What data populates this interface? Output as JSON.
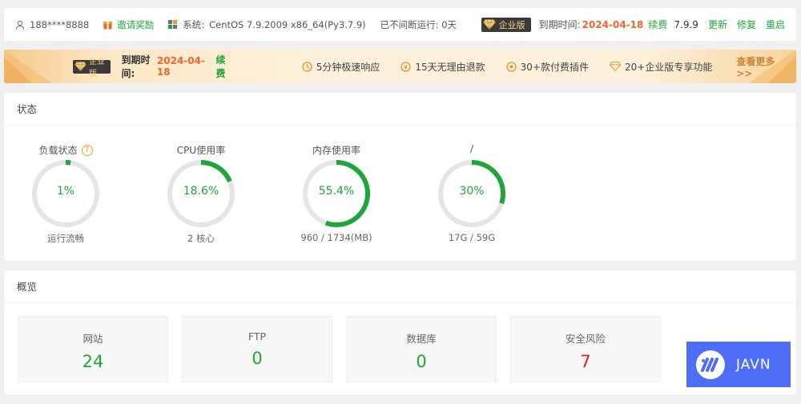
{
  "header": {
    "user": "188****8888",
    "invite": "邀请奖励",
    "system_label": "系统:",
    "system_value": "CentOS 7.9.2009 x86_64(Py3.7.9)",
    "uptime": "已不间断运行: 0天",
    "edition_badge": "企业版",
    "expire_label": "到期时间:",
    "expire_date": "2024-04-18",
    "renew": "续费",
    "version": "7.9.9",
    "update": "更新",
    "repair": "修复",
    "restart": "重启"
  },
  "banner": {
    "edition_badge": "企业版",
    "expire_label": "到期时间:",
    "expire_date": "2024-04-18",
    "renew": "续费",
    "features": [
      {
        "icon": "clock-icon",
        "text": "5分钟极速响应"
      },
      {
        "icon": "refund-icon",
        "text": "15天无理由退款"
      },
      {
        "icon": "plugin-icon",
        "text": "30+款付费插件"
      },
      {
        "icon": "diamond-icon",
        "text": "20+企业版专享功能"
      }
    ],
    "more": "查看更多>>"
  },
  "status": {
    "title": "状态",
    "gauges": [
      {
        "label": "负载状态",
        "value": "1%",
        "percent": 1,
        "sub": "运行流畅",
        "help": "?"
      },
      {
        "label": "CPU使用率",
        "value": "18.6%",
        "percent": 18.6,
        "sub": "2 核心"
      },
      {
        "label": "内存使用率",
        "value": "55.4%",
        "percent": 55.4,
        "sub": "960 / 1734(MB)"
      },
      {
        "label": "/",
        "value": "30%",
        "percent": 30,
        "sub": "17G / 59G"
      }
    ]
  },
  "overview": {
    "title": "概览",
    "boxes": [
      {
        "label": "网站",
        "value": "24"
      },
      {
        "label": "FTP",
        "value": "0"
      },
      {
        "label": "数据库",
        "value": "0"
      },
      {
        "label": "安全风险",
        "value": "7"
      }
    ]
  },
  "watermark": {
    "text": "JAVN"
  },
  "colors": {
    "accent": "#20a53a",
    "orange": "#f0652d",
    "danger": "#e02020",
    "track": "#e5e5e5"
  }
}
